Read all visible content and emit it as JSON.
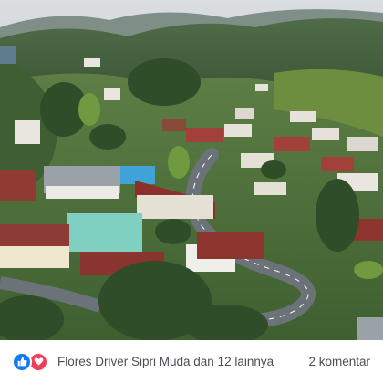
{
  "post": {
    "reactors_text": "Flores Driver Sipri Muda dan 12 lainnya",
    "comments_text": "2 komentar"
  },
  "reactions": {
    "icons": [
      "like-icon",
      "love-icon"
    ],
    "like_color": "#1877f2",
    "love_color": "#f33e58"
  }
}
